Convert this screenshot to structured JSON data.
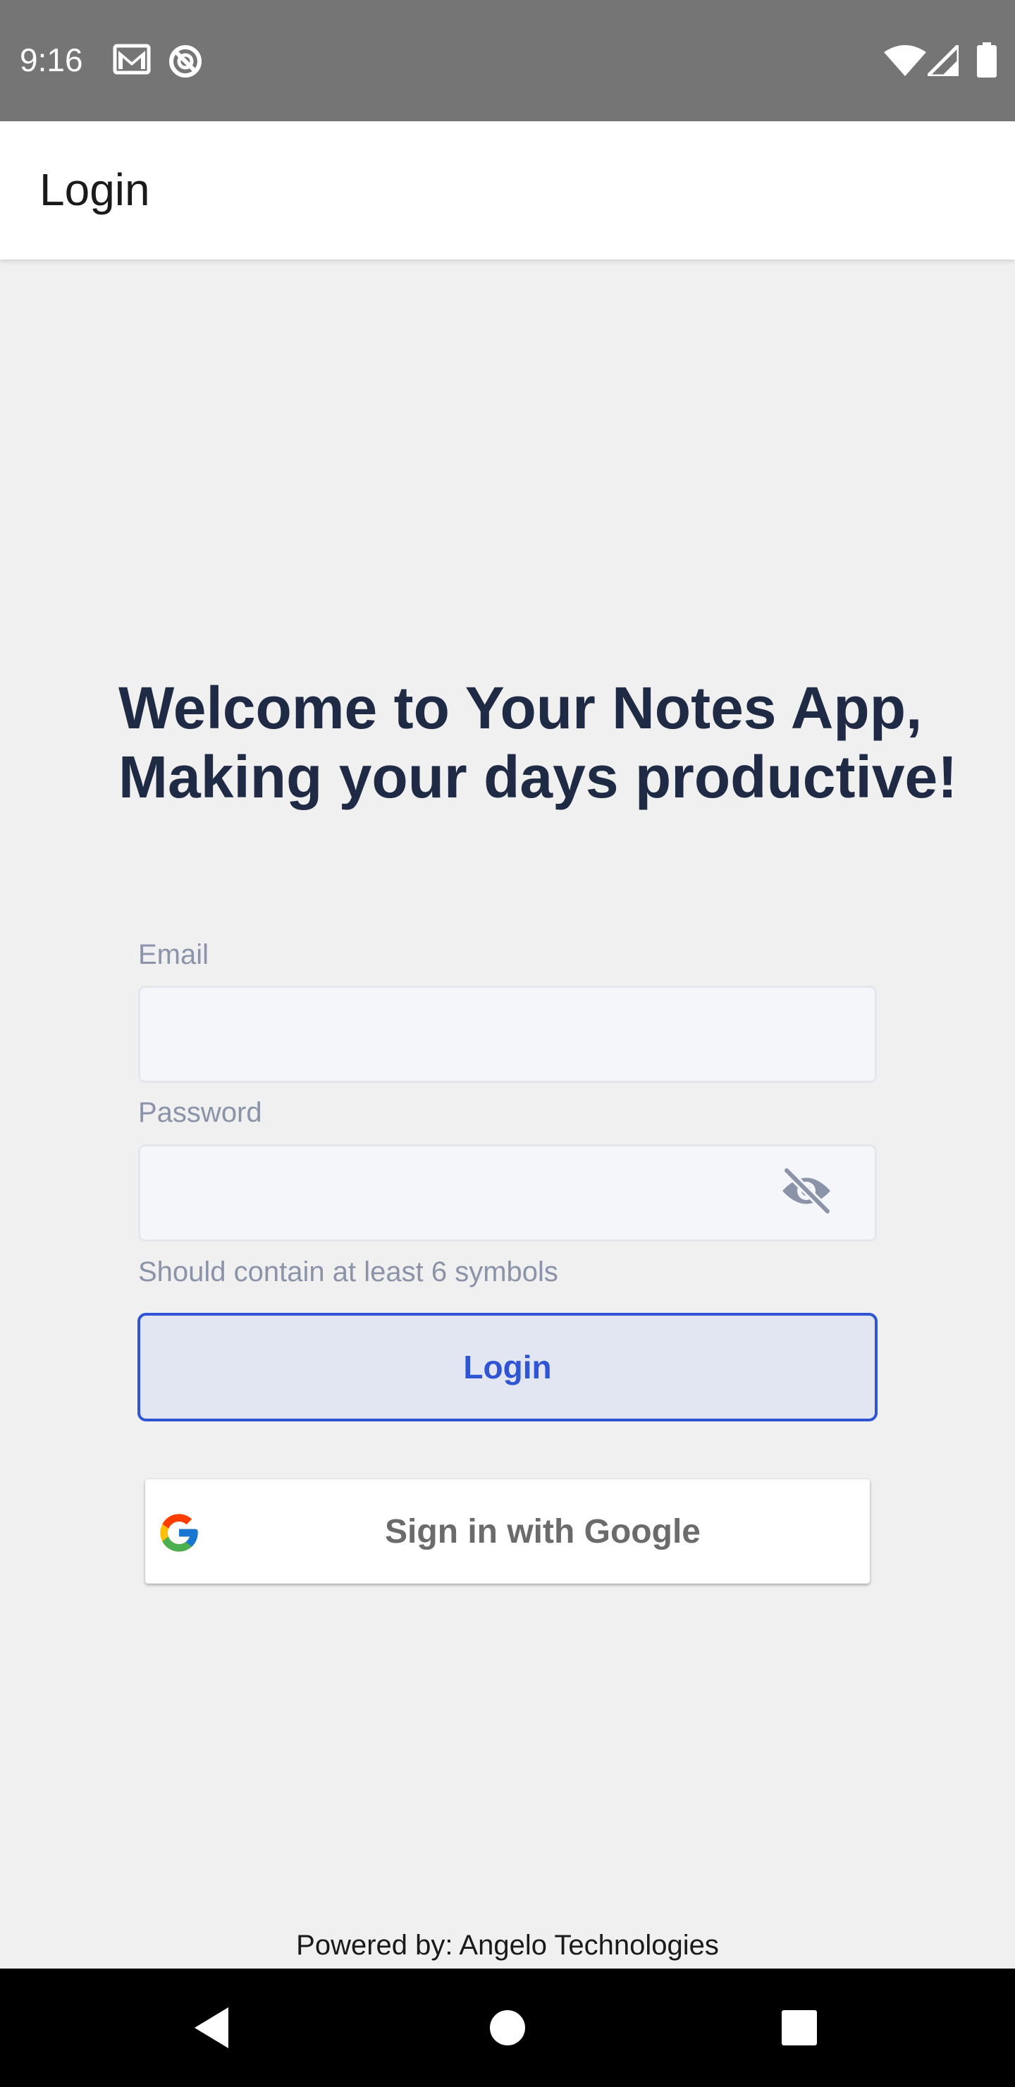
{
  "status_bar": {
    "time": "9:16",
    "left_icons": [
      "gmail-icon",
      "do-not-disturb-icon"
    ],
    "right_icons": [
      "wifi-icon",
      "cellular-signal-icon",
      "battery-icon"
    ]
  },
  "app_bar": {
    "title": "Login"
  },
  "welcome": {
    "line1": "Welcome to Your Notes App,",
    "line2": "Making your days productive!"
  },
  "form": {
    "email": {
      "label": "Email",
      "value": "",
      "placeholder": ""
    },
    "password": {
      "label": "Password",
      "value": "",
      "placeholder": "",
      "visibility_icon": "eye-off-icon"
    },
    "hint": "Should contain at least 6 symbols",
    "login_label": "Login"
  },
  "google_signin": {
    "label": "Sign in with Google",
    "icon": "google-g-icon"
  },
  "footer": {
    "powered_by": "Powered by: Angelo Technologies"
  },
  "nav_bar": {
    "buttons": [
      "back-icon",
      "home-icon",
      "recents-icon"
    ]
  },
  "colors": {
    "status_bar": "#757575",
    "background": "#f0f0f0",
    "heading": "#1f2a44",
    "accent": "#2f55d4",
    "login_fill": "#e2e6f2",
    "muted_text": "#8a93a8"
  }
}
